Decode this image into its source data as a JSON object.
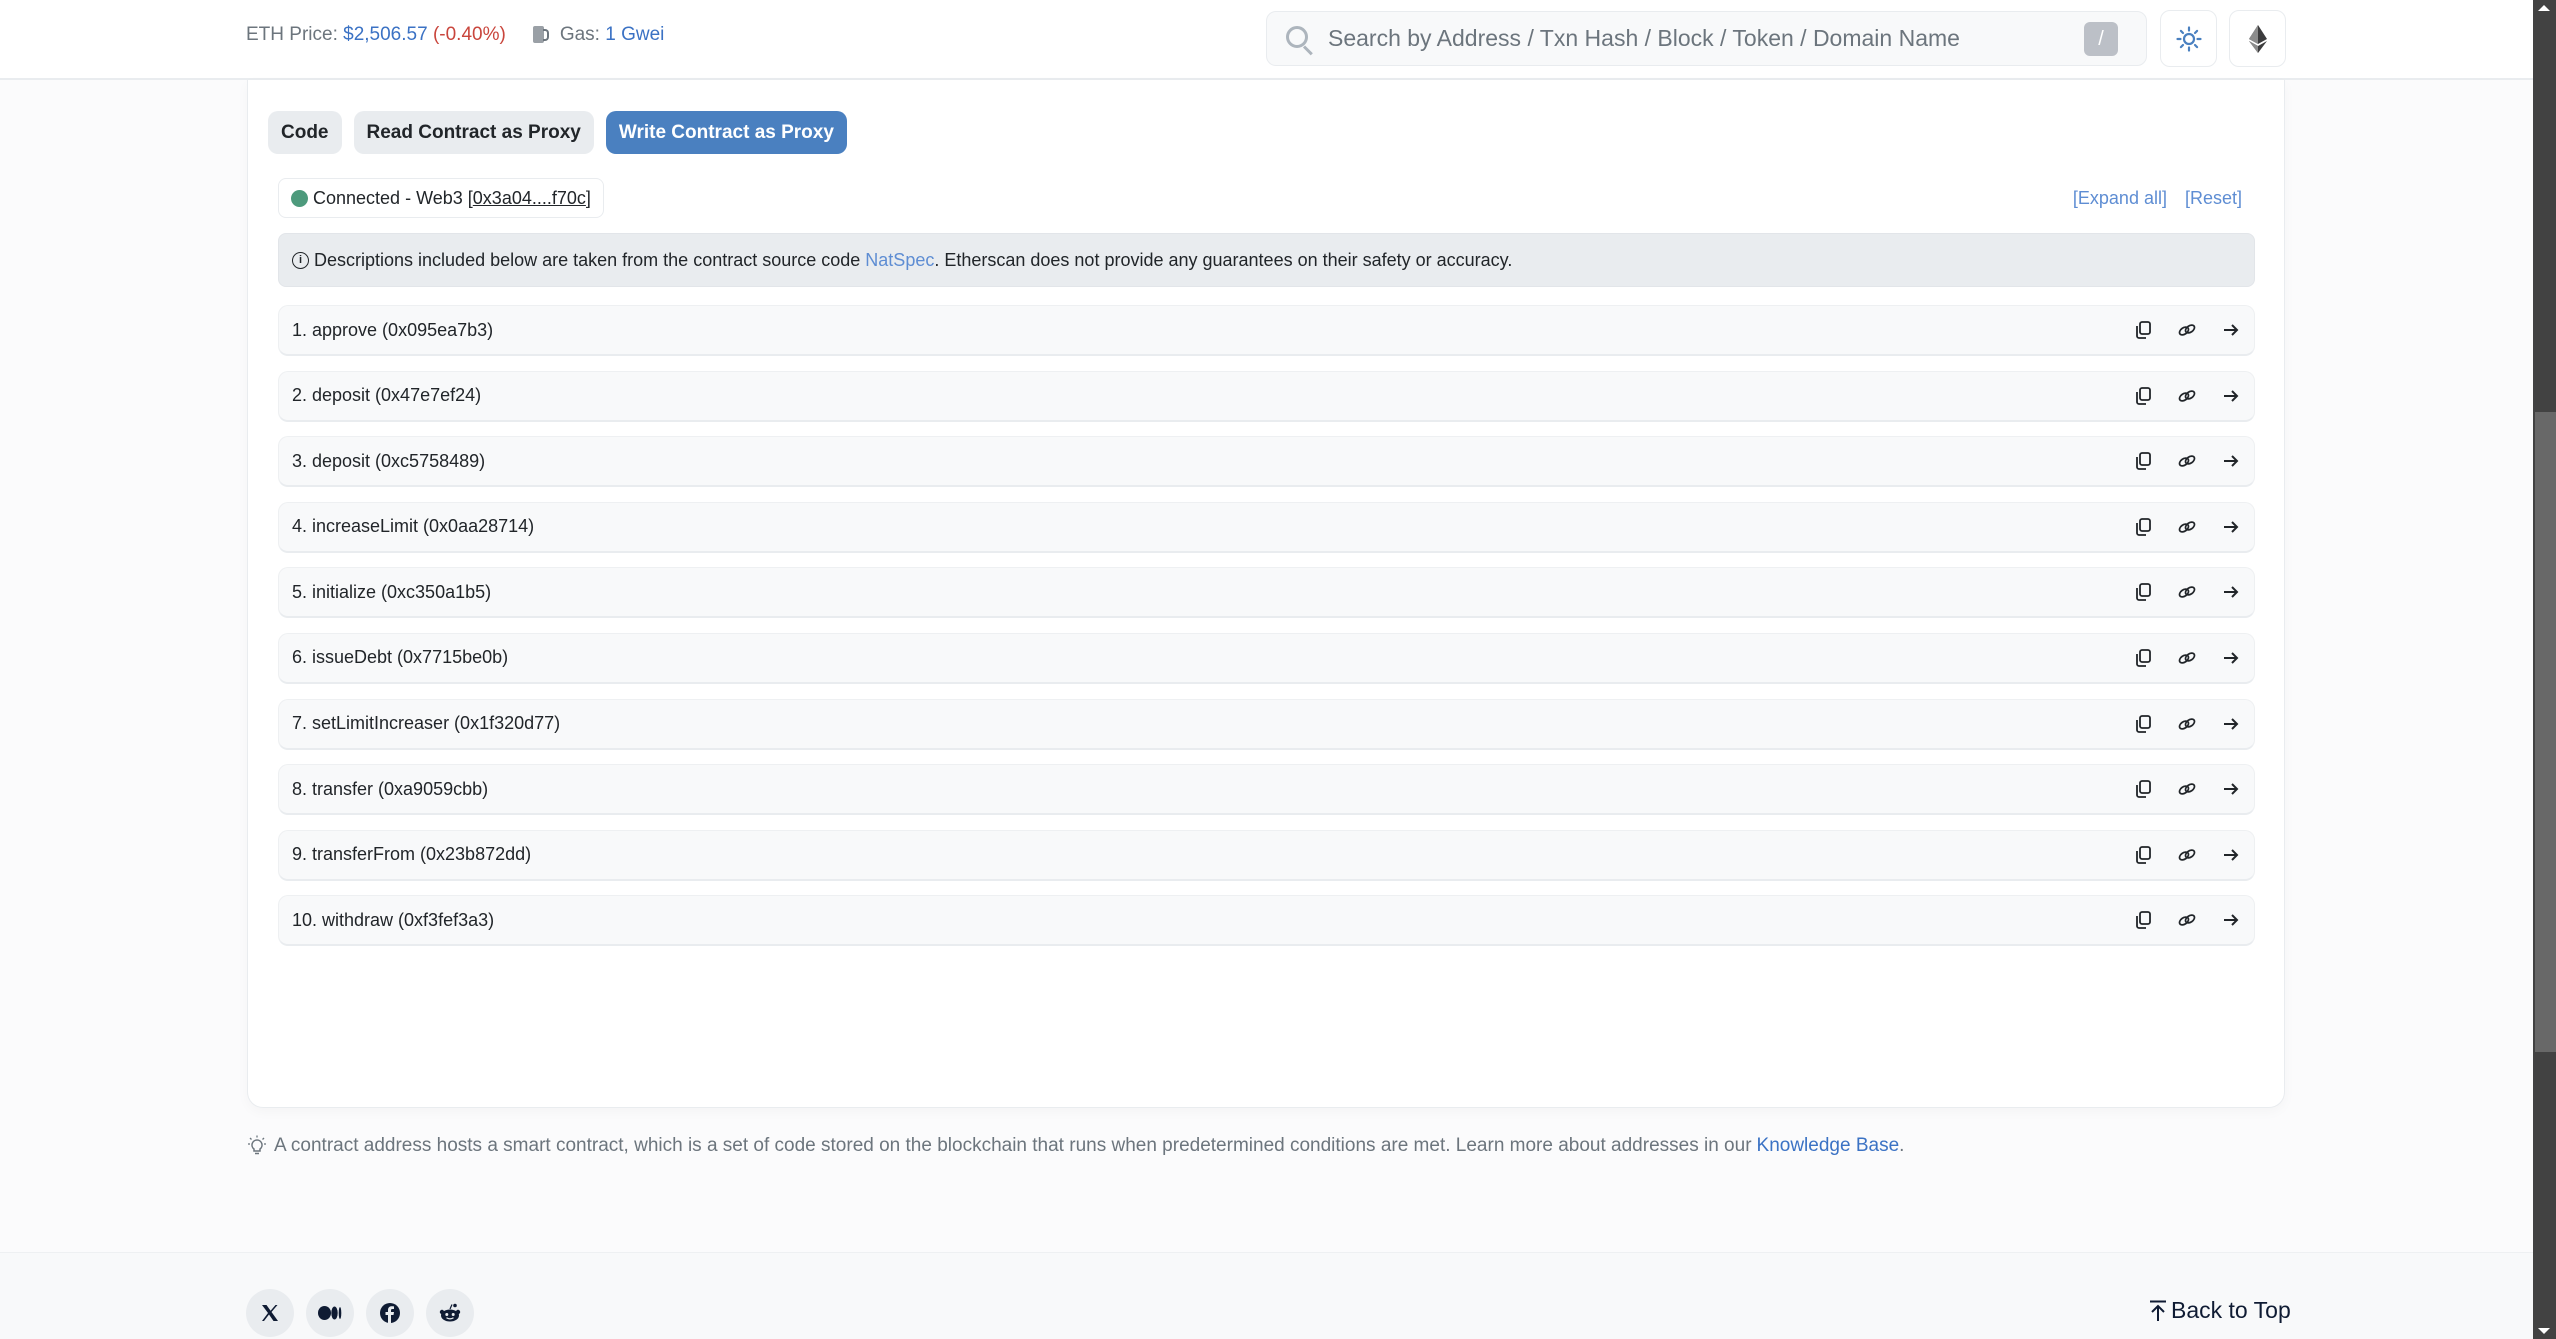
{
  "header": {
    "eth_price_label": "ETH Price:",
    "eth_price_value": "$2,506.57",
    "eth_price_change": "(-0.40%)",
    "gas_label": "Gas:",
    "gas_value": "1 Gwei",
    "search_placeholder": "Search by Address / Txn Hash / Block / Token / Domain Name",
    "search_shortcut": "/",
    "theme_icon": "sun-icon",
    "network_icon": "ethereum-icon"
  },
  "tabs": [
    {
      "label": "Code",
      "active": false
    },
    {
      "label": "Read Contract as Proxy",
      "active": false
    },
    {
      "label": "Write Contract as Proxy",
      "active": true
    }
  ],
  "connection": {
    "status": "Connected",
    "separator": " - ",
    "provider": "Web3",
    "address": "0x3a04....f70c",
    "dot_color": "#4d9a7c"
  },
  "controls": {
    "expand_all": "[Expand all]",
    "reset": "[Reset]"
  },
  "notice": {
    "text_before": "Descriptions included below are taken from the contract source code ",
    "link": "NatSpec",
    "text_after": ". Etherscan does not provide any guarantees on their safety or accuracy."
  },
  "functions": [
    {
      "label": "1. approve (0x095ea7b3)"
    },
    {
      "label": "2. deposit (0x47e7ef24)"
    },
    {
      "label": "3. deposit (0xc5758489)"
    },
    {
      "label": "4. increaseLimit (0x0aa28714)"
    },
    {
      "label": "5. initialize (0xc350a1b5)"
    },
    {
      "label": "6. issueDebt (0x7715be0b)"
    },
    {
      "label": "7. setLimitIncreaser (0x1f320d77)"
    },
    {
      "label": "8. transfer (0xa9059cbb)"
    },
    {
      "label": "9. transferFrom (0x23b872dd)"
    },
    {
      "label": "10. withdraw (0xf3fef3a3)"
    }
  ],
  "row_actions": [
    "copy-icon",
    "link-icon",
    "arrow-right-icon"
  ],
  "bottom_note": {
    "text": "A contract address hosts a smart contract, which is a set of code stored on the blockchain that runs when predetermined conditions are met. Learn more about addresses in our",
    "link": "Knowledge Base",
    "end": "."
  },
  "footer": {
    "socials": [
      "x-icon",
      "medium-icon",
      "facebook-icon",
      "reddit-icon"
    ],
    "back_to_top": "Back to Top"
  },
  "colors": {
    "accent": "#4a80c0",
    "link": "#3b72c4",
    "negative": "#c9453c"
  }
}
